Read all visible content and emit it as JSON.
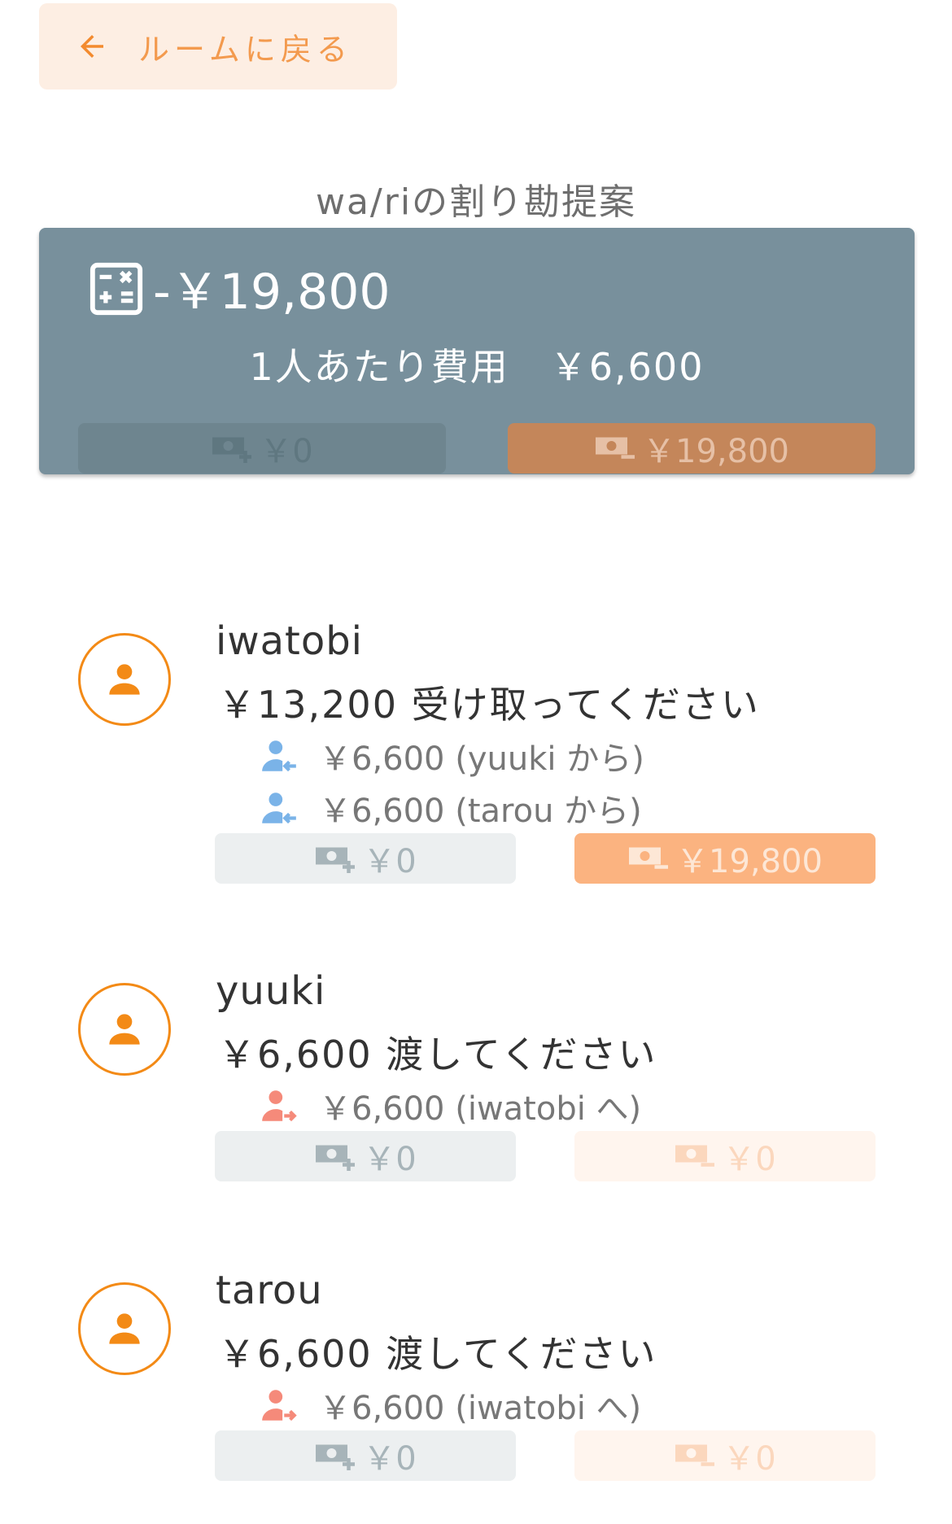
{
  "back_button": {
    "label": "ルームに戻る",
    "icon": "arrow-left-icon"
  },
  "section_title": "wa/riの割り勘提案",
  "summary": {
    "total": "-￥19,800",
    "per_person_label": "1人あたり費用",
    "per_person_amount": "￥6,600",
    "received": "￥0",
    "paid": "￥19,800"
  },
  "members": [
    {
      "name": "iwatobi",
      "instruction": "￥13,200 受け取ってください",
      "transfers": [
        {
          "text": "￥6,600 (yuuki から)",
          "direction": "receive"
        },
        {
          "text": "￥6,600 (tarou から)",
          "direction": "receive"
        }
      ],
      "received": "￥0",
      "paid": "￥19,800"
    },
    {
      "name": "yuuki",
      "instruction": "￥6,600 渡してください",
      "transfers": [
        {
          "text": "￥6,600 (iwatobi へ)",
          "direction": "send"
        }
      ],
      "received": "￥0",
      "paid": "￥0"
    },
    {
      "name": "tarou",
      "instruction": "￥6,600 渡してください",
      "transfers": [
        {
          "text": "￥6,600 (iwatobi へ)",
          "direction": "send"
        }
      ],
      "received": "￥0",
      "paid": "￥0"
    }
  ],
  "colors": {
    "accent": "#f38a16",
    "summary_bg": "#78909c",
    "receive_icon": "#7ab3e8",
    "send_icon": "#f58a7a"
  }
}
